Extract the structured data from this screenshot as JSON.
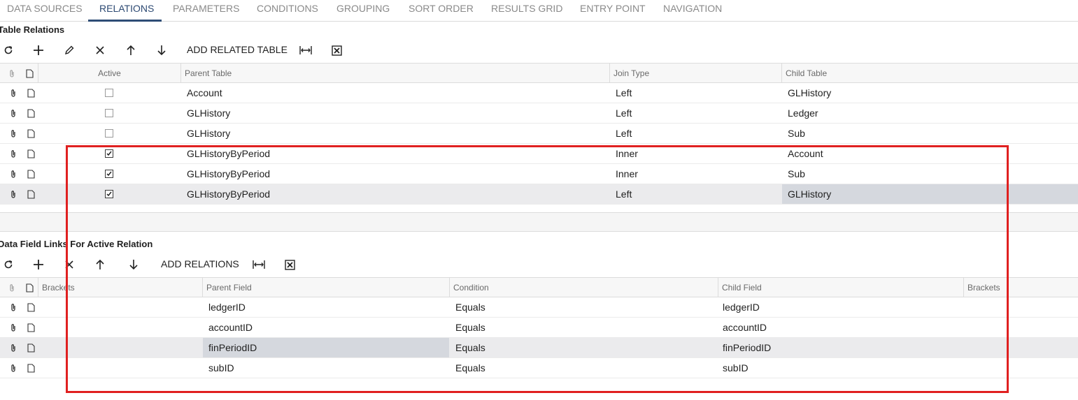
{
  "tabs": [
    {
      "label": "DATA SOURCES"
    },
    {
      "label": "RELATIONS",
      "active": true
    },
    {
      "label": "PARAMETERS"
    },
    {
      "label": "CONDITIONS"
    },
    {
      "label": "GROUPING"
    },
    {
      "label": "SORT ORDER"
    },
    {
      "label": "RESULTS GRID"
    },
    {
      "label": "ENTRY POINT"
    },
    {
      "label": "NAVIGATION"
    }
  ],
  "table_relations": {
    "title": "Table Relations",
    "toolbar": {
      "add_related_table": "ADD RELATED TABLE"
    },
    "columns": {
      "active": "Active",
      "parent_table": "Parent Table",
      "join_type": "Join Type",
      "child_table": "Child Table"
    },
    "rows": [
      {
        "active": false,
        "parent_table": "Account",
        "join_type": "Left",
        "child_table": "GLHistory"
      },
      {
        "active": false,
        "parent_table": "GLHistory",
        "join_type": "Left",
        "child_table": "Ledger"
      },
      {
        "active": false,
        "parent_table": "GLHistory",
        "join_type": "Left",
        "child_table": "Sub"
      },
      {
        "active": true,
        "parent_table": "GLHistoryByPeriod",
        "join_type": "Inner",
        "child_table": "Account"
      },
      {
        "active": true,
        "parent_table": "GLHistoryByPeriod",
        "join_type": "Inner",
        "child_table": "Sub"
      },
      {
        "active": true,
        "parent_table": "GLHistoryByPeriod",
        "join_type": "Left",
        "child_table": "GLHistory"
      }
    ]
  },
  "field_links": {
    "title": "Data Field Links For Active Relation",
    "toolbar": {
      "add_relations": "ADD RELATIONS"
    },
    "columns": {
      "brackets_open": "Brackets",
      "parent_field": "Parent Field",
      "condition": "Condition",
      "child_field": "Child Field",
      "brackets_close": "Brackets"
    },
    "rows": [
      {
        "parent_field": "ledgerID",
        "condition": "Equals",
        "child_field": "ledgerID"
      },
      {
        "parent_field": "accountID",
        "condition": "Equals",
        "child_field": "accountID"
      },
      {
        "parent_field": "finPeriodID",
        "condition": "Equals",
        "child_field": "finPeriodID"
      },
      {
        "parent_field": "subID",
        "condition": "Equals",
        "child_field": "subID"
      }
    ]
  },
  "colors": {
    "accent": "#2e4d76",
    "annotation": "#e02020",
    "selected_row": "#ebebed",
    "selected_cell": "#d5d8de"
  }
}
